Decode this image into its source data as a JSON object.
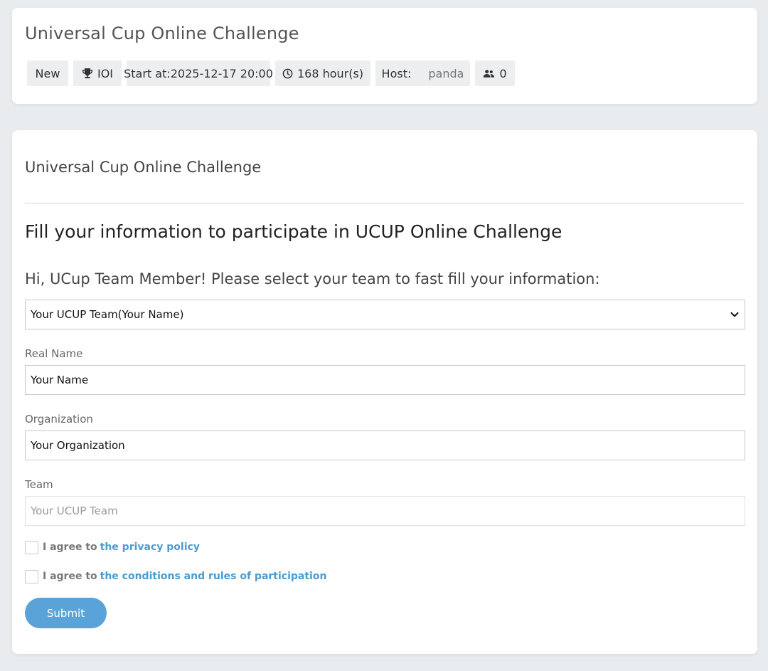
{
  "contest": {
    "title": "Universal Cup Online Challenge",
    "badges": {
      "status": "New",
      "format": "IOI",
      "start": "Start at:2025-12-17 20:00",
      "duration": "168 hour(s)",
      "host_label": "Host:",
      "host_name": "panda",
      "participants": "0"
    },
    "icons": {
      "format": "trophy-icon",
      "duration": "clock-icon",
      "participants": "users-icon"
    }
  },
  "form_card": {
    "section_title": "Universal Cup Online Challenge",
    "heading": "Fill your information to participate in UCUP Online Challenge",
    "fastfill_label": "Hi, UCup Team Member! Please select your team to fast fill your information:",
    "team_select": {
      "selected": "Your UCUP Team(Your Name)",
      "icon": "chevron-down-icon"
    },
    "fields": {
      "real_name": {
        "label": "Real Name",
        "value": "Your Name"
      },
      "organization": {
        "label": "Organization",
        "value": "Your Organization"
      },
      "team": {
        "label": "Team",
        "placeholder": "Your UCUP Team"
      }
    },
    "checkboxes": {
      "privacy": {
        "prefix": "I agree to",
        "link": "the privacy policy"
      },
      "rules": {
        "prefix": "I agree to",
        "link": "the conditions and rules of participation"
      }
    },
    "submit_label": "Submit"
  },
  "colors": {
    "page_background": "#e9ecef",
    "card_background": "#ffffff",
    "badge_background": "#eceeef",
    "link": "#4a9bd1",
    "submit_button": "#5aa3d9"
  }
}
